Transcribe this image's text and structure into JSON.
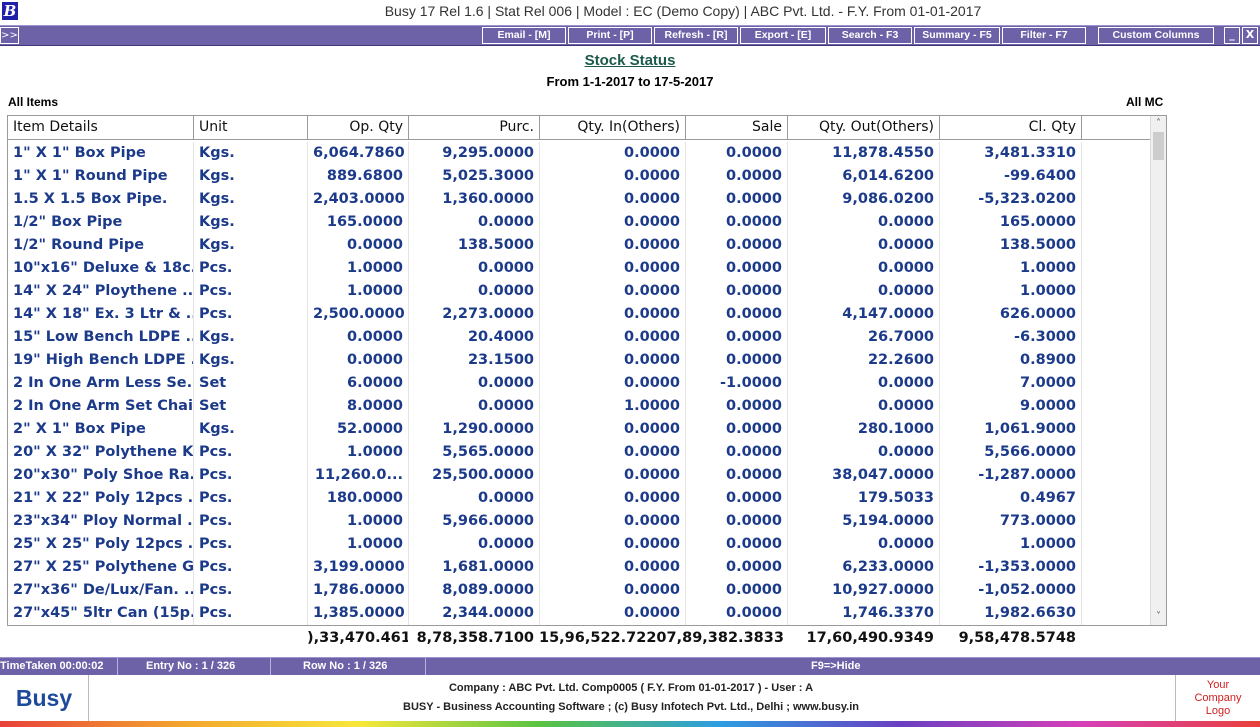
{
  "window": {
    "title": "Busy 17  Rel 1.6  |  Stat Rel 006  |  Model : EC (Demo Copy)  |  ABC Pvt. Ltd. - F.Y. From 01-01-2017",
    "app_icon_letter": "B"
  },
  "toolbar": {
    "expand": ">>",
    "email": "Email - [M]",
    "print": "Print - [P]",
    "refresh": "Refresh - [R]",
    "export": "Export - [E]",
    "search": "Search - F3",
    "summary": "Summary - F5",
    "filter": "Filter - F7",
    "custom_columns": "Custom Columns",
    "minimize": "_",
    "close": "X"
  },
  "report": {
    "title": "Stock Status",
    "period": "From 1-1-2017 to 17-5-2017",
    "filter_left": "All Items",
    "filter_right": "All MC"
  },
  "columns": [
    "Item Details",
    "Unit",
    "Op. Qty",
    "Purc.",
    "Qty. In(Others)",
    "Sale",
    "Qty. Out(Others)",
    "Cl. Qty"
  ],
  "rows": [
    [
      "1\" X 1\" Box Pipe",
      "Kgs.",
      "6,064.7860",
      "9,295.0000",
      "0.0000",
      "0.0000",
      "11,878.4550",
      "3,481.3310"
    ],
    [
      "1\" X 1\" Round Pipe",
      "Kgs.",
      "889.6800",
      "5,025.3000",
      "0.0000",
      "0.0000",
      "6,014.6200",
      "-99.6400"
    ],
    [
      "1.5 X 1.5 Box Pipe.",
      "Kgs.",
      "2,403.0000",
      "1,360.0000",
      "0.0000",
      "0.0000",
      "9,086.0200",
      "-5,323.0200"
    ],
    [
      "1/2\" Box Pipe",
      "Kgs.",
      "165.0000",
      "0.0000",
      "0.0000",
      "0.0000",
      "0.0000",
      "165.0000"
    ],
    [
      "1/2\" Round Pipe",
      "Kgs.",
      "0.0000",
      "138.5000",
      "0.0000",
      "0.0000",
      "0.0000",
      "138.5000"
    ],
    [
      "10\"x16\" Deluxe & 18c...",
      "Pcs.",
      "1.0000",
      "0.0000",
      "0.0000",
      "0.0000",
      "0.0000",
      "1.0000"
    ],
    [
      "14\"  X 24\" Ploythene ...",
      "Pcs.",
      "1.0000",
      "0.0000",
      "0.0000",
      "0.0000",
      "0.0000",
      "1.0000"
    ],
    [
      "14\" X 18\" Ex. 3 Ltr & ...",
      "Pcs.",
      "2,500.0000",
      "2,273.0000",
      "0.0000",
      "0.0000",
      "4,147.0000",
      "626.0000"
    ],
    [
      "15\" Low Bench LDPE ...",
      "Kgs.",
      "0.0000",
      "20.4000",
      "0.0000",
      "0.0000",
      "26.7000",
      "-6.3000"
    ],
    [
      "19\" High Bench LDPE ...",
      "Kgs.",
      "0.0000",
      "23.1500",
      "0.0000",
      "0.0000",
      "22.2600",
      "0.8900"
    ],
    [
      "2 In One Arm Less Se...",
      "Set",
      "6.0000",
      "0.0000",
      "0.0000",
      "-1.0000",
      "0.0000",
      "7.0000"
    ],
    [
      "2 In One Arm Set Chair",
      "Set",
      "8.0000",
      "0.0000",
      "1.0000",
      "0.0000",
      "0.0000",
      "9.0000"
    ],
    [
      "2\" X 1\" Box Pipe",
      "Kgs.",
      "52.0000",
      "1,290.0000",
      "0.0000",
      "0.0000",
      "280.1000",
      "1,061.9000"
    ],
    [
      "20\" X 32\" Polythene K...",
      "Pcs.",
      "1.0000",
      "5,565.0000",
      "0.0000",
      "0.0000",
      "0.0000",
      "5,566.0000"
    ],
    [
      "20\"x30\" Poly Shoe Ra...",
      "Pcs.",
      "11,260.0...",
      "25,500.0000",
      "0.0000",
      "0.0000",
      "38,047.0000",
      "-1,287.0000"
    ],
    [
      "21\" X 22\" Poly 12pcs ...",
      "Pcs.",
      "180.0000",
      "0.0000",
      "0.0000",
      "0.0000",
      "179.5033",
      "0.4967"
    ],
    [
      "23\"x34\" Ploy Normal ...",
      "Pcs.",
      "1.0000",
      "5,966.0000",
      "0.0000",
      "0.0000",
      "5,194.0000",
      "773.0000"
    ],
    [
      "25\" X 25\" Poly 12pcs ...",
      "Pcs.",
      "1.0000",
      "0.0000",
      "0.0000",
      "0.0000",
      "0.0000",
      "1.0000"
    ],
    [
      "27\" X 25\" Polythene G...",
      "Pcs.",
      "3,199.0000",
      "1,681.0000",
      "0.0000",
      "0.0000",
      "6,233.0000",
      "-1,353.0000"
    ],
    [
      "27\"x36\" De/Lux/Fan. ...",
      "Pcs.",
      "1,786.0000",
      "8,089.0000",
      "0.0000",
      "0.0000",
      "10,927.0000",
      "-1,052.0000"
    ],
    [
      "27\"x45\" 5ltr Can (15p...",
      "Pcs.",
      "1,385.0000",
      "2,344.0000",
      "0.0000",
      "0.0000",
      "1,746.3370",
      "1,982.6630"
    ]
  ],
  "totals": {
    "op_qty": "),33,470.4610",
    "purc": "8,78,358.7100",
    "qty_in_sale": "15,96,522.72207,89,382.3833",
    "qty_out": "17,60,490.9349",
    "cl_qty": "9,58,478.5748"
  },
  "status": {
    "time_taken": "TimeTaken 00:00:02",
    "entry_no": "Entry No : 1 / 326",
    "row_no": "Row No : 1 / 326",
    "hint": "F9=>Hide"
  },
  "footer": {
    "logo": "Busy",
    "company_line": "Company : ABC Pvt. Ltd. Comp0005 ( F.Y. From 01-01-2017 ) - User : A",
    "software_line": "BUSY - Business Accounting Software  ;  (c) Busy Infotech Pvt. Ltd., Delhi  ;  www.busy.in",
    "company_logo_line1": "Your",
    "company_logo_line2": "Company",
    "company_logo_line3": "Logo"
  },
  "scroll": {
    "up": "˄",
    "down": "˅"
  }
}
